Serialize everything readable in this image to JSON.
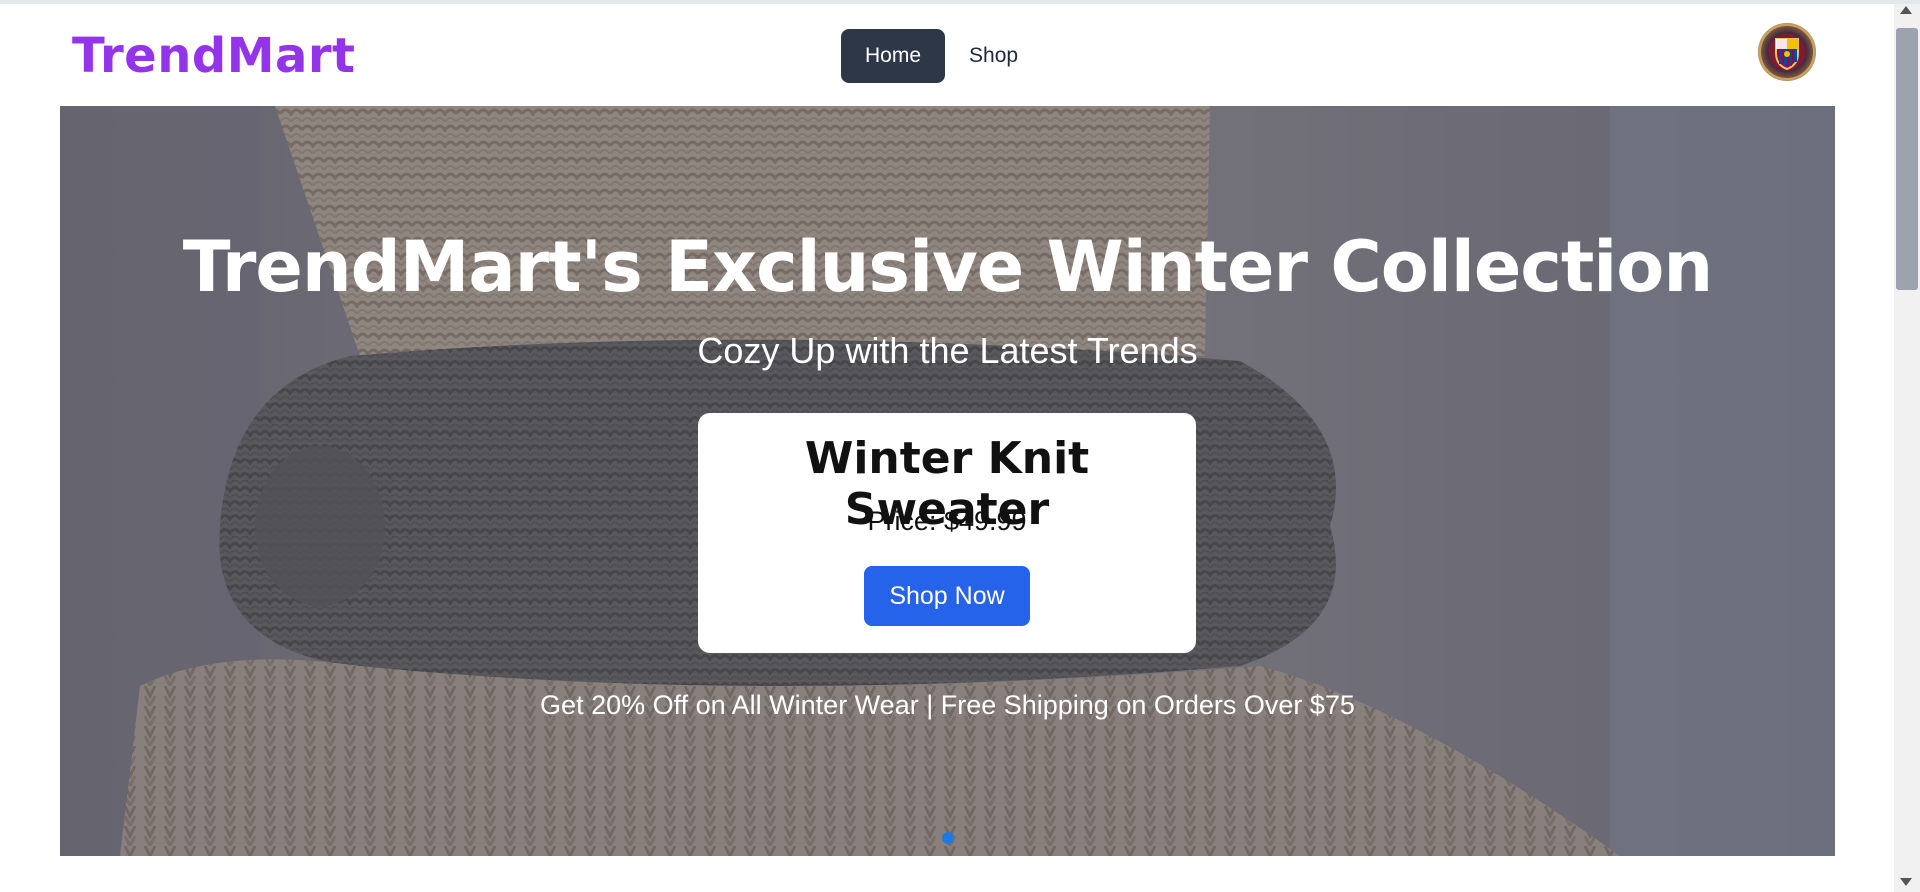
{
  "brand": {
    "logo_text": "TrendMart",
    "logo_color": "#9333ea"
  },
  "nav": {
    "items": [
      {
        "label": "Home",
        "active": true
      },
      {
        "label": "Shop",
        "active": false
      }
    ],
    "active_bg": "#2d3748"
  },
  "user": {
    "avatar_icon": "user-avatar-icon"
  },
  "hero": {
    "title": "TrendMart's Exclusive Winter Collection",
    "subtitle": "Cozy Up with the Latest Trends",
    "product": {
      "name": "Winter Knit Sweater",
      "price": "Price: $49.99",
      "cta_label": "Shop Now"
    },
    "promo": "Get 20% Off on All Winter Wear | Free Shipping on Orders Over $75",
    "carousel": {
      "slide_count": 1,
      "active_index": 0
    },
    "cta_color": "#2563eb"
  }
}
